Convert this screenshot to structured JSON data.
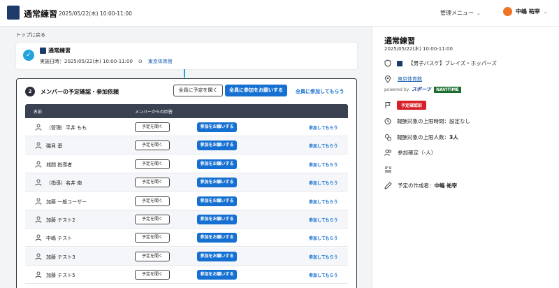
{
  "header": {
    "title": "通常練習",
    "datetime": "2025/05/22(木) 10:00-11:00",
    "admin_menu": "管理メニュー",
    "user_name": "中嶋 祐宰"
  },
  "breadcrumb": {
    "back_label": "トップに戻る"
  },
  "event": {
    "title": "通常練習",
    "datetime_label": "実施日時：",
    "datetime": "2025/05/22(木) 10:00-11:00",
    "location": "東京体育館"
  },
  "members": {
    "step": "2",
    "title": "メンバーの予定確認・参加依頼",
    "open_all_label": "全員に予定を聞く",
    "request_all_label": "全員に参加をお願いする",
    "join_all_label": "全員に参加してもらう",
    "col_name": "名前",
    "col_response": "メンバーからの回答",
    "ask_label": "予定を聞く",
    "request_label": "参加をお願いする",
    "join_label": "参加してもらう",
    "rows": [
      "（管理）平井 もも",
      "磯貝 基",
      "城間 指導者",
      "（指導）名井 南",
      "加藤 一般ユーザー",
      "加藤 テスト2",
      "中嶋 テスト",
      "加藤 テスト3",
      "加藤 テスト5"
    ]
  },
  "detail": {
    "title": "通常練習",
    "datetime": "2025/05/22(木) 10:00-11:00",
    "team": "【男子バスケ】ブレイズ・ホッパーズ",
    "location": "東京体育館",
    "powered_by": "powered by",
    "powered_logo1": "スポーツ",
    "powered_logo2": "NAVITIME",
    "status_badge": "予定確認前",
    "reward_time": "報酬対象の上限時間：設定なし",
    "reward_people_label": "報酬対象の上限人数：",
    "reward_people_value": "3人",
    "confirmed": "参加確定（-人）",
    "creator_label": "予定の作成者：",
    "creator_name": "中嶋 祐宰"
  },
  "colors": {
    "accent": "#1570d2",
    "check": "#22a3dd",
    "badge": "#d61f26",
    "avatar": "#f07522"
  }
}
